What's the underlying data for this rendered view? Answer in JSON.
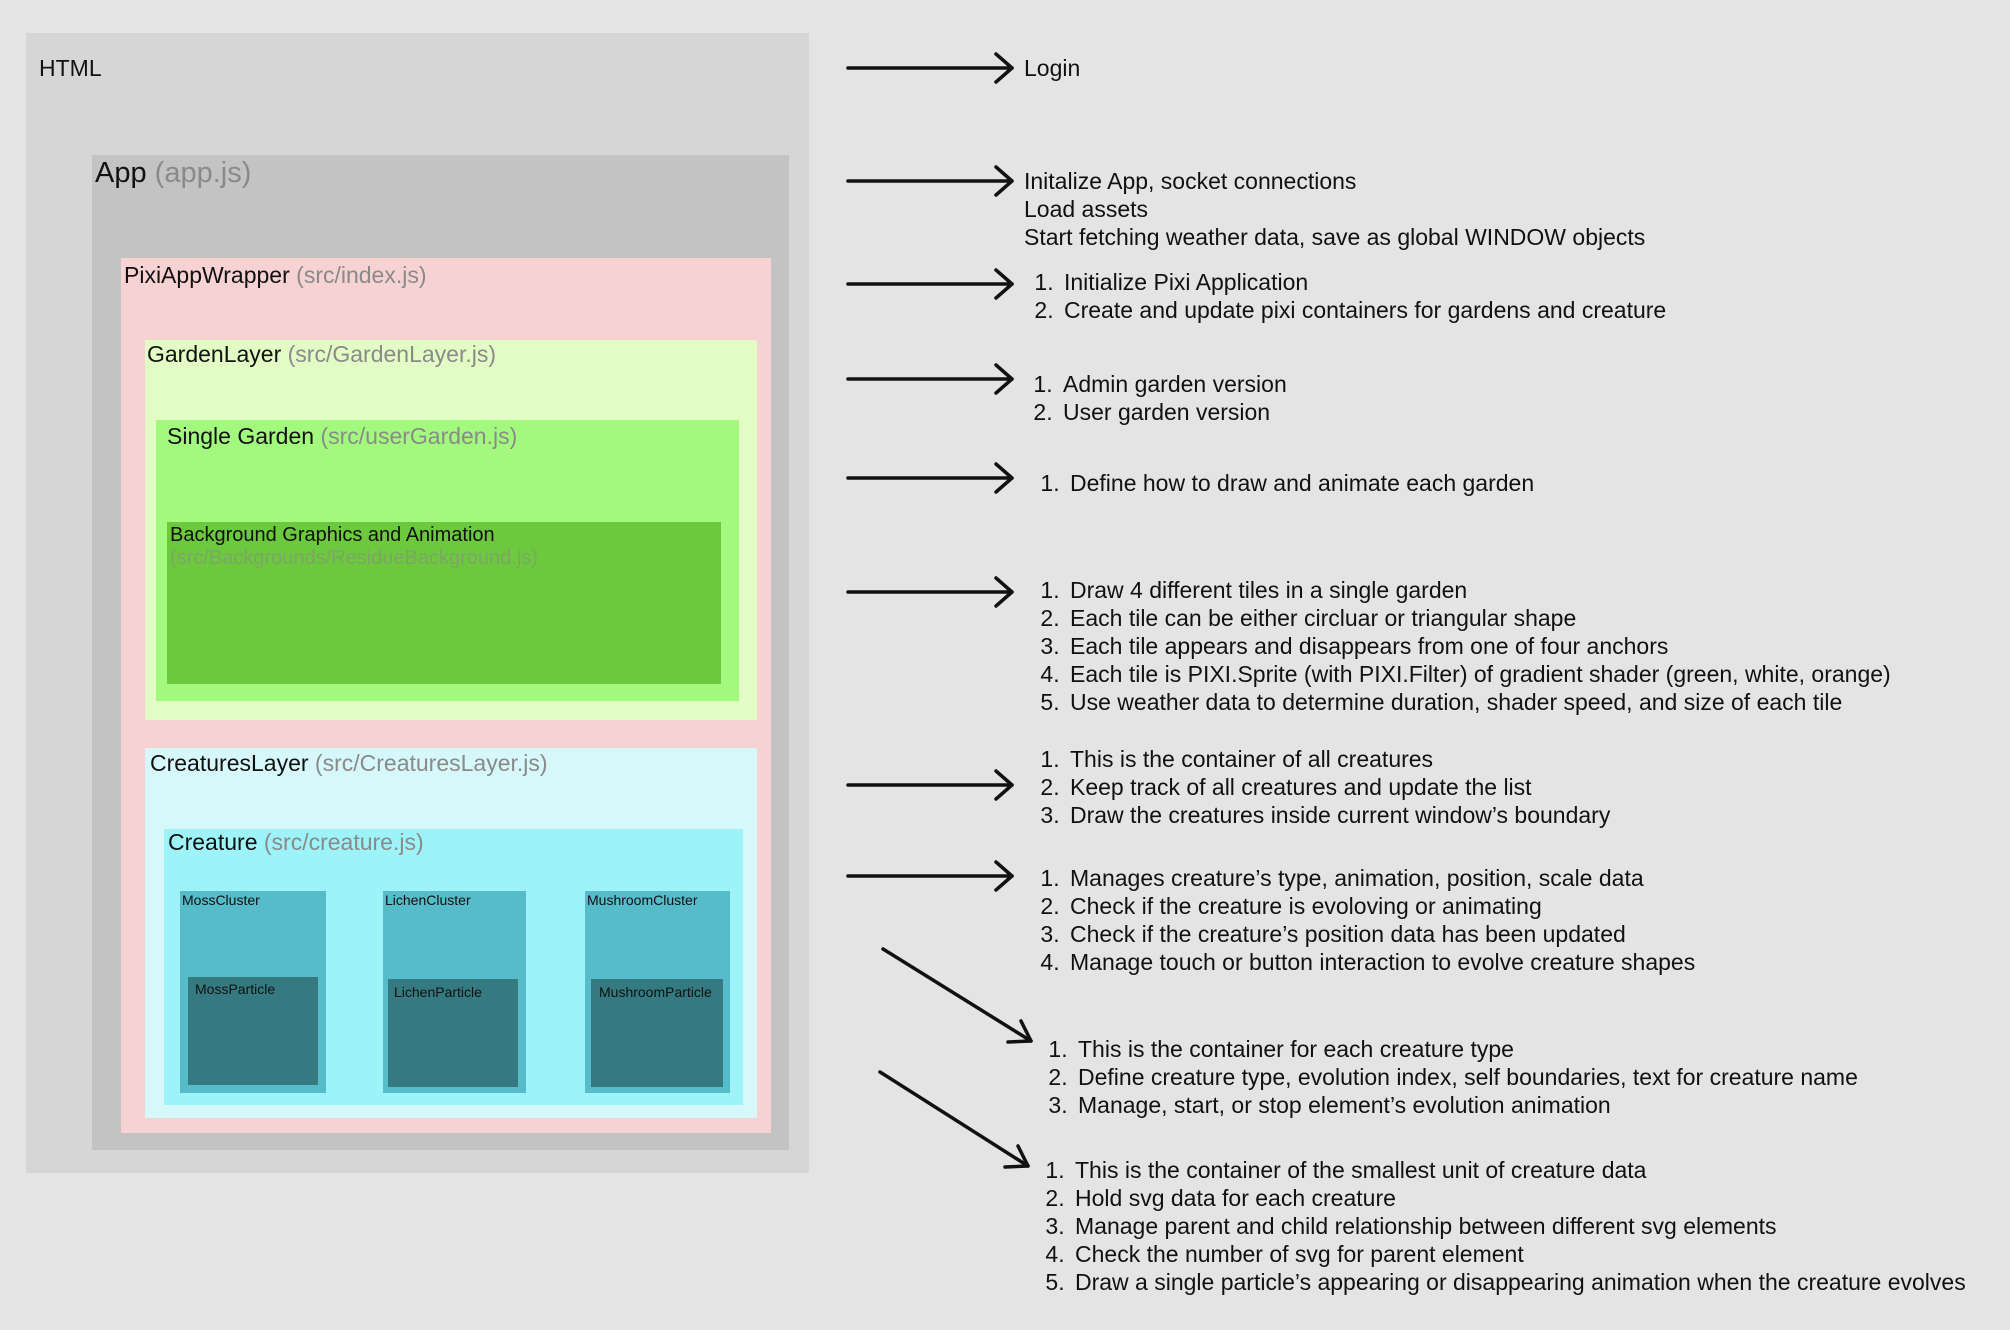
{
  "diagram": {
    "html": {
      "title": "HTML"
    },
    "app": {
      "title": "App",
      "path": "(app.js)"
    },
    "pixi_wrapper": {
      "title": "PixiAppWrapper",
      "path": "(src/index.js)"
    },
    "garden_layer": {
      "title": "GardenLayer",
      "path": "(src/GardenLayer.js)"
    },
    "single_garden": {
      "title": "Single Garden",
      "path": "(src/userGarden.js)"
    },
    "background": {
      "title": "Background Graphics and Animation",
      "path": "(src/Backgrounds/ResidueBackground.js)"
    },
    "creatures_layer": {
      "title": "CreaturesLayer",
      "path": "(src/CreaturesLayer.js)"
    },
    "creature": {
      "title": "Creature",
      "path": "(src/creature.js)"
    },
    "clusters": [
      {
        "cluster": "MossCluster",
        "particle": "MossParticle"
      },
      {
        "cluster": "LichenCluster",
        "particle": "LichenParticle"
      },
      {
        "cluster": "MushroomCluster",
        "particle": "MushroomParticle"
      }
    ]
  },
  "notes": {
    "login": "Login",
    "app": [
      "Initalize App, socket connections",
      "Load assets",
      "Start fetching weather data, save as global WINDOW objects"
    ],
    "pixi": [
      "Initialize Pixi Application",
      "Create and update pixi containers for gardens and creature"
    ],
    "garden_layer": [
      "Admin garden version",
      "User garden version"
    ],
    "single_garden": [
      "Define how to draw and animate each garden"
    ],
    "background": [
      "Draw 4 different tiles in a single garden",
      "Each tile can be either circluar or triangular shape",
      "Each tile appears and disappears from one of four anchors",
      "Each tile is PIXI.Sprite (with PIXI.Filter) of gradient shader (green, white, orange)",
      "Use weather data to determine duration, shader speed, and size of each tile"
    ],
    "creatures_layer": [
      "This is the container of all creatures",
      "Keep track of all creatures and update the list",
      "Draw the creatures inside current window’s boundary"
    ],
    "creature": [
      "Manages creature’s type, animation, position, scale data",
      "Check if the creature is evoloving or animating",
      "Check if the creature’s position data has been updated",
      "Manage touch or button interaction to evolve creature shapes"
    ],
    "cluster": [
      "This is the container for each creature type",
      "Define creature type, evolution index, self boundaries, text for creature name",
      "Manage, start, or stop element’s evolution animation"
    ],
    "particle": [
      "This is the container of the smallest unit of creature data",
      "Hold svg data for each creature",
      "Manage parent and child relationship between different svg elements",
      "Check the number of svg for parent element",
      "Draw a single particle’s appearing or disappearing animation when the creature evolves"
    ]
  },
  "colors": {
    "background": "#e4e4e4",
    "html": "#d6d6d6",
    "app": "#c3c3c3",
    "pixi_wrapper": "#f7d2d2",
    "garden_layer": "#e3fbc4",
    "single_garden": "#a3f97d",
    "background_anim": "#6cc83d",
    "creatures_layer": "#d6f8fa",
    "creature": "#9ef3f8",
    "cluster": "#56bcca",
    "particle": "#347a80"
  }
}
